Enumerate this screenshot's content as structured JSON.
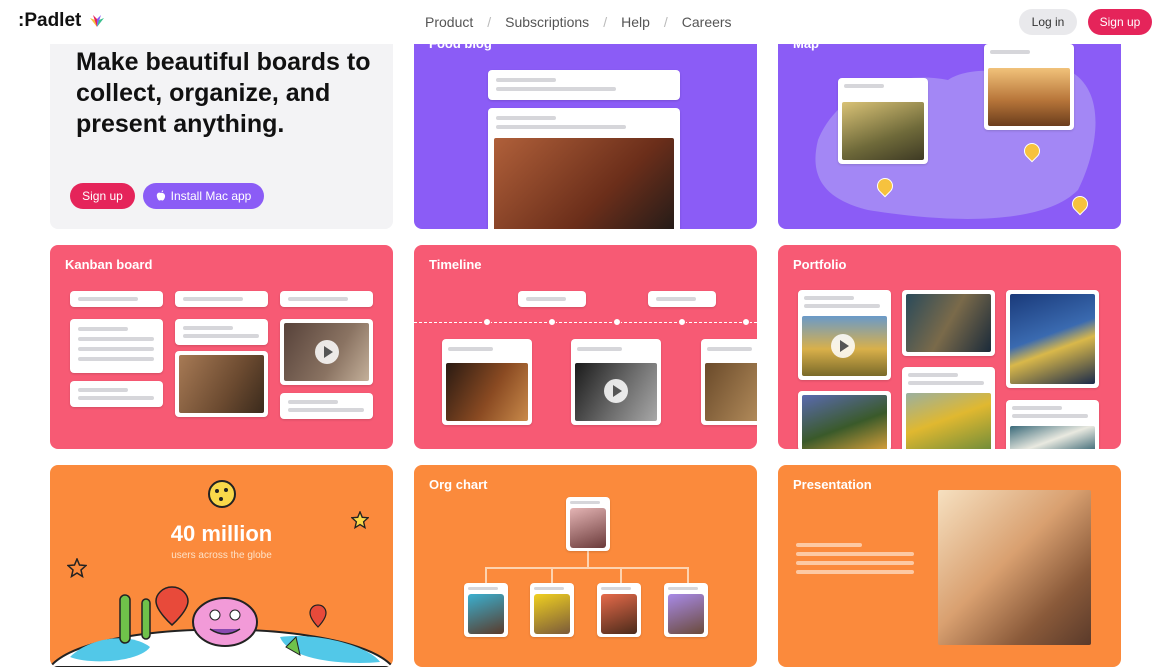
{
  "header": {
    "logo_text": ":Padlet",
    "nav": [
      "Product",
      "Subscriptions",
      "Help",
      "Careers"
    ],
    "nav_sep": "/",
    "login_label": "Log in",
    "signup_label": "Sign up"
  },
  "hero": {
    "title": "Make beautiful boards to collect, organize, and present anything.",
    "signup_label": "Sign up",
    "install_label": "Install Mac app",
    "apple_icon": "apple-icon"
  },
  "tiles": {
    "food_blog": "Food blog",
    "map": "Map",
    "kanban": "Kanban board",
    "timeline": "Timeline",
    "portfolio": "Portfolio",
    "org_chart": "Org chart",
    "presentation": "Presentation"
  },
  "stats": {
    "count": "40 million",
    "caption": "users across the globe"
  },
  "colors": {
    "brand_pink": "#e5245a",
    "purple": "#8b5cf6",
    "tile_pink": "#f75a74",
    "orange": "#fb8a3c"
  }
}
